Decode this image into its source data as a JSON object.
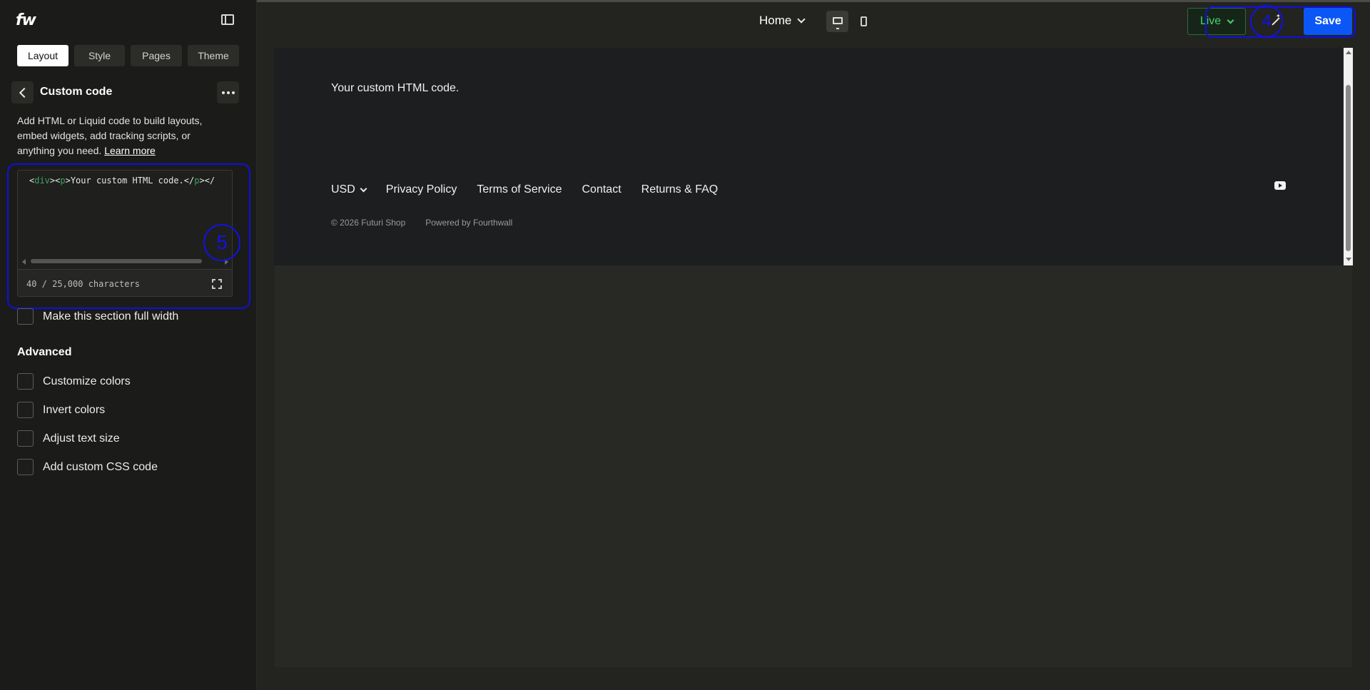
{
  "app": {
    "logo_text": "fw"
  },
  "sidebar": {
    "tabs": [
      {
        "label": "Layout",
        "active": true
      },
      {
        "label": "Style",
        "active": false
      },
      {
        "label": "Pages",
        "active": false
      },
      {
        "label": "Theme",
        "active": false
      }
    ],
    "section_title": "Custom code",
    "description": "Add HTML or Liquid code to build layouts, embed widgets, add tracking scripts, or anything you need.",
    "learn_more": "Learn more",
    "code_editor": {
      "tokens": [
        "<",
        "div",
        "><",
        "p",
        ">Your custom HTML code.</",
        "p",
        "></"
      ],
      "char_count": "40 / 25,000 characters"
    },
    "marker_code": "5",
    "full_width_label": "Make this section full width",
    "advanced": {
      "title": "Advanced",
      "options": [
        "Customize colors",
        "Invert colors",
        "Adjust text size",
        "Add custom CSS code"
      ]
    }
  },
  "topbar": {
    "page_select": "Home",
    "live_label": "Live",
    "marker_toolbar": "4",
    "save_label": "Save"
  },
  "preview": {
    "custom_text": "Your custom HTML code.",
    "currency": "USD",
    "footer_links": [
      "Privacy Policy",
      "Terms of Service",
      "Contact",
      "Returns & FAQ"
    ],
    "copyright": "© 2026 Futuri Shop",
    "powered_by": "Powered by Fourthwall"
  },
  "colors": {
    "accent_save": "#0b57f5",
    "live_green": "#4cd06c",
    "annotation_blue": "#1010e0"
  }
}
